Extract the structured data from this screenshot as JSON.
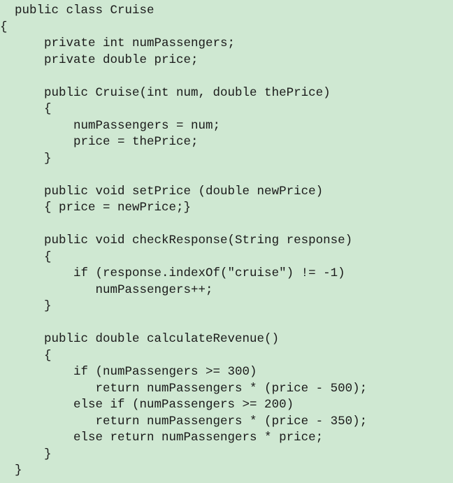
{
  "code_lines": [
    {
      "text": "  public class Cruise"
    },
    {
      "text": "{"
    },
    {
      "text": "      private int numPassengers;"
    },
    {
      "text": "      private double price;"
    },
    {
      "text": ""
    },
    {
      "text": "      public Cruise(int num, double thePrice)"
    },
    {
      "text": "      {"
    },
    {
      "text": "          numPassengers = num;"
    },
    {
      "text": "          price = thePrice;"
    },
    {
      "text": "      }"
    },
    {
      "text": ""
    },
    {
      "text": "      public void setPrice (double newPrice)"
    },
    {
      "text": "      { price = newPrice;}"
    },
    {
      "text": ""
    },
    {
      "text": "      public void checkResponse(String response)"
    },
    {
      "text": "      {"
    },
    {
      "text": "          if (response.indexOf(\"cruise\") != -1)"
    },
    {
      "text": "             numPassengers++;"
    },
    {
      "text": "      }"
    },
    {
      "text": ""
    },
    {
      "text": "      public double calculateRevenue()"
    },
    {
      "text": "      {"
    },
    {
      "text": "          if (numPassengers >= 300)"
    },
    {
      "text": "             return numPassengers * (price - 500);"
    },
    {
      "text": "          else if (numPassengers >= 200)"
    },
    {
      "text": "             return numPassengers * (price - 350);"
    },
    {
      "text": "          else return numPassengers * price;"
    },
    {
      "text": "      }"
    },
    {
      "text": "  }"
    }
  ]
}
